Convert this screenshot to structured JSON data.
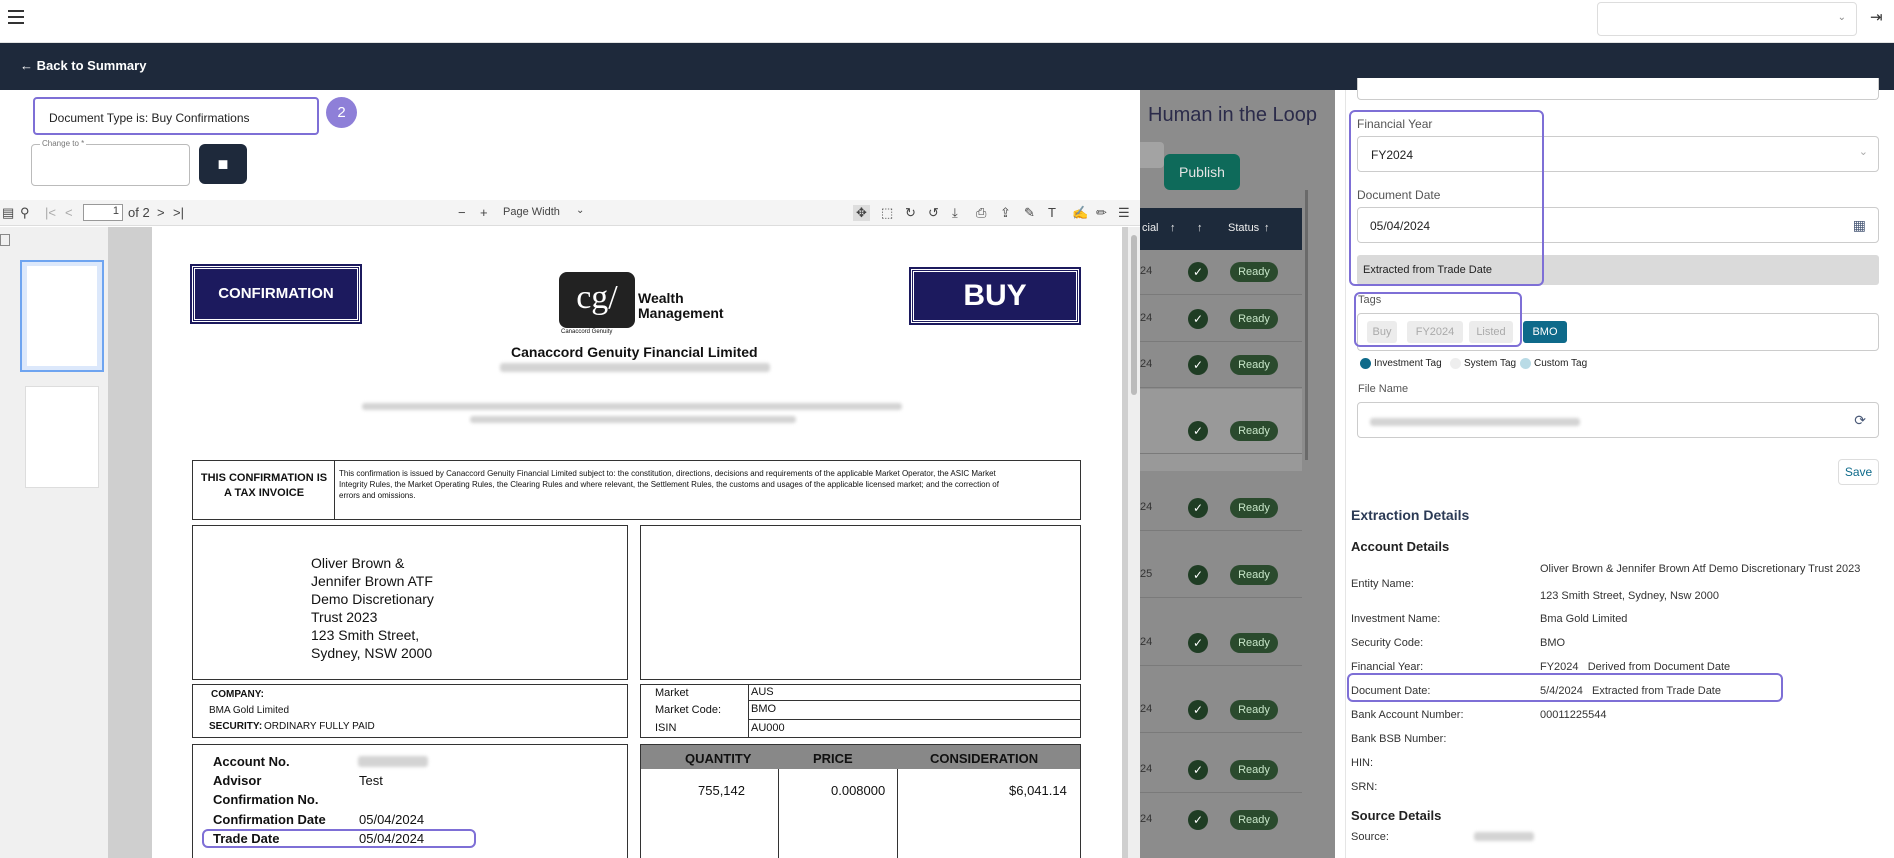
{
  "topbar": {
    "menu_icon": "hamburger-icon",
    "logout_icon": "logout-icon"
  },
  "nav": {
    "back_label": "← Back to Summary"
  },
  "doc_type": {
    "label": "Document Type is: Buy Confirmations",
    "step": "2",
    "change_to_label": "Change to *"
  },
  "pdf_toolbar": {
    "page_value": "1",
    "page_of": "of 2",
    "zoom": "Page Width"
  },
  "document": {
    "confirmation_label": "CONFIRMATION",
    "buy_label": "BUY",
    "logo_text": "cg/",
    "logo_sub": "Canaccord Genuity",
    "wealth": "Wealth",
    "management": "Management",
    "issuer": "Canaccord Genuity Financial Limited",
    "tax_invoice": "THIS CONFIRMATION IS A TAX INVOICE",
    "disclaimer": "This confirmation is issued by Canaccord Genuity Financial Limited subject to: the constitution, directions, decisions and requirements of the applicable Market Operator, the ASIC Market Integrity Rules, the Market Operating Rules, the Clearing Rules and where relevant, the Settlement Rules, the customs and usages of the applicable licensed market; and the correction of errors and omissions.",
    "address_lines": [
      "Oliver Brown &",
      "Jennifer Brown ATF",
      "Demo Discretionary",
      "Trust 2023",
      "123 Smith Street,",
      "Sydney, NSW 2000"
    ],
    "company_label": "COMPANY:",
    "company_value": "BMA Gold Limited",
    "security_label": "SECURITY:",
    "security_value": "ORDINARY FULLY PAID",
    "market_label": "Market",
    "market_value": "AUS",
    "market_code_label": "Market Code:",
    "market_code_value": "BMO",
    "isin_label": "ISIN",
    "isin_value": "AU000",
    "account_no_label": "Account No.",
    "advisor_label": "Advisor",
    "advisor_value": "Test",
    "conf_no_label": "Confirmation No.",
    "conf_date_label": "Confirmation Date",
    "conf_date_value": "05/04/2024",
    "trade_date_label": "Trade Date",
    "trade_date_value": "05/04/2024",
    "headers": [
      "QUANTITY",
      "PRICE",
      "CONSIDERATION"
    ],
    "quantity": "755,142",
    "price": "0.008000",
    "consideration": "$6,041.14"
  },
  "middle": {
    "title": "Human in the Loop",
    "publish_label": "Publish",
    "col_cial": "cial",
    "col_status": "Status",
    "row_suffixes": [
      "24",
      "24",
      "24",
      "",
      "24",
      "25",
      "24",
      "24",
      "24",
      "24"
    ],
    "ready_label": "Ready"
  },
  "right": {
    "financial_year_label": "Financial Year",
    "financial_year_value": "FY2024",
    "document_date_label": "Document Date",
    "document_date_value": "05/04/2024",
    "extracted_note": "Extracted from Trade Date",
    "tags_label": "Tags",
    "tags": [
      "Buy",
      "FY2024",
      "Listed",
      "BMO"
    ],
    "legend": [
      "Investment Tag",
      "System Tag",
      "Custom Tag"
    ],
    "file_name_label": "File Name",
    "save_label": "Save",
    "extraction_title": "Extraction Details",
    "account_title": "Account Details",
    "kv": [
      {
        "k": "Entity Name:",
        "v": "Oliver Brown & Jennifer Brown Atf Demo Discretionary Trust 2023"
      },
      {
        "k": "",
        "v": "123 Smith Street, Sydney, Nsw 2000"
      },
      {
        "k": "Investment Name:",
        "v": "Bma Gold Limited"
      },
      {
        "k": "Security Code:",
        "v": "BMO"
      },
      {
        "k": "Financial Year:",
        "v": "FY2024   Derived from Document Date"
      },
      {
        "k": "Document Date:",
        "v": "5/4/2024   Extracted from Trade Date"
      },
      {
        "k": "Bank Account Number:",
        "v": "00011225544"
      },
      {
        "k": "Bank BSB Number:",
        "v": ""
      },
      {
        "k": "HIN:",
        "v": ""
      },
      {
        "k": "SRN:",
        "v": ""
      }
    ],
    "source_title": "Source Details",
    "source_label": "Source:"
  },
  "colors": {
    "navy": "#1e293b",
    "accent": "#7e6fd6",
    "teal": "#0e6a8a",
    "ready": "#2a4a2d"
  }
}
